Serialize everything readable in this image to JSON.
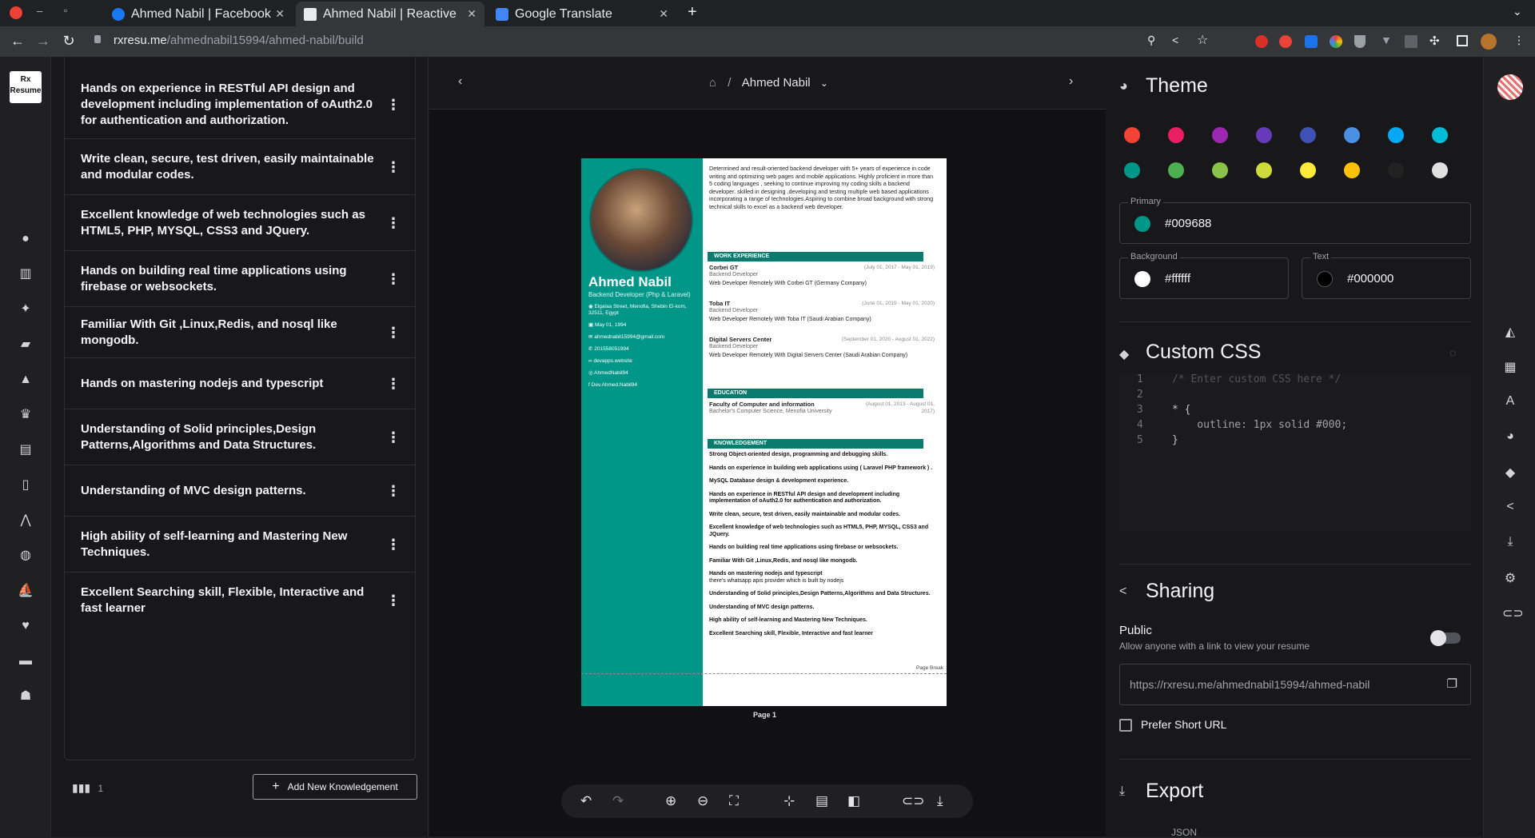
{
  "browser": {
    "tabs": [
      {
        "title": "Ahmed Nabil | Facebook"
      },
      {
        "title": "Ahmed Nabil | Reactive Re"
      },
      {
        "title": "Google Translate"
      }
    ],
    "url_domain": "rxresu.me",
    "url_path": "/ahmednabil15994/ahmed-nabil/build"
  },
  "app": {
    "logo": "Rx Resume"
  },
  "knowledgement": {
    "items": [
      "Hands on experience in RESTful API design and development including implementation of oAuth2.0 for authentication and authorization.",
      "Write clean, secure, test driven, easily maintainable and modular codes.",
      "Excellent knowledge of web technologies such as HTML5, PHP, MYSQL, CSS3 and JQuery.",
      "Hands on building real time applications using firebase or websockets.",
      "Familiar With Git ,Linux,Redis, and nosql like mongodb.",
      "Hands on mastering nodejs and typescript",
      "Understanding of Solid principles,Design Patterns,Algorithms and Data Structures.",
      "Understanding of MVC design patterns.",
      "High ability of self-learning and Mastering New Techniques.",
      "Excellent Searching skill, Flexible, Interactive and fast learner"
    ],
    "columns": "1",
    "add_button": "Add New Knowledgement"
  },
  "center": {
    "breadcrumb_name": "Ahmed Nabil",
    "page_label": "Page 1",
    "page_break": "Page Break"
  },
  "resume": {
    "name": "Ahmed Nabil",
    "title": "Backend Developer (Php & Laravel)",
    "address": "Elgalaa Street, Menofia, Shebin El-kom, 32511, Egypt",
    "birthdate": "May 01, 1994",
    "email": "ahmednabil15994@gmail.com",
    "phone": "201558051994",
    "website": "devapps.website",
    "github": "AhmedNabil94",
    "facebook": "Dev.Ahmed.Nabil94",
    "summary": "Determined and result-oriented backend developer with 5+ years of experience in code writing and optimizing web pages and mobile applications. Highly proficient in more than 5 coding languages , seeking to continue improving my coding skills a backend developer. skilled in designing ,developing and testing multiple web based applications incorporating a range of technologies.Aspiring to combine broad background with strong technical skills to excel as a backend web developer.",
    "sections": {
      "work": "WORK EXPERIENCE",
      "education": "EDUCATION",
      "knowledge": "KNOWLEDGEMENT"
    },
    "work": [
      {
        "company": "Corbei GT",
        "role": "Backend Developer",
        "date": "(July 01, 2017 - May 01, 2019)",
        "desc": "Web Developer Remotely With Corbei GT (Germany Company)"
      },
      {
        "company": "Toba IT",
        "role": "Backend Developer",
        "date": "(June 01, 2019 - May 01, 2020)",
        "desc": "Web Developer Remotely With Toba IT (Saudi Arabian Company)"
      },
      {
        "company": "Digital Servers Center",
        "role": "Backend Developer",
        "date": "(September 01, 2020 - August 01, 2022)",
        "desc": "Web Developer Remotely With Digital Servers Center (Saudi Arabian Company)"
      }
    ],
    "education": {
      "school": "Faculty of Computer and information",
      "degree": "Bachelor's Computer Science, Menofia University",
      "date": "(August 01, 2013 - August 01, 2017)"
    },
    "knowledge": [
      "Strong Object-oriented design, programming and debugging skills.",
      "Hands on experience in building web applications using ( Laravel PHP framework ) .",
      "MySQL Database design & development experience.",
      "Hands on experience in RESTful API design and development including implementation of oAuth2.0 for authentication and authorization.",
      "Write clean, secure, test driven, easily maintainable and modular codes.",
      "Excellent knowledge of web technologies such as HTML5, PHP, MYSQL, CSS3 and JQuery.",
      "Hands on building real time applications using firebase or websockets.",
      "Familiar With Git ,Linux,Redis, and nosql like mongodb.",
      "Hands on mastering nodejs and typescript",
      "there's whatsapp apis provider which is built by nodejs",
      "Understanding of Solid principles,Design Patterns,Algorithms and Data Structures.",
      "Understanding of MVC design patterns.",
      "High ability of self-learning and Mastering New Techniques.",
      "Excellent Searching skill, Flexible, Interactive and fast learner"
    ]
  },
  "theme": {
    "heading": "Theme",
    "swatches": [
      "#f44336",
      "#e91e63",
      "#9c27b0",
      "#673ab7",
      "#3f51b5",
      "#4a90e2",
      "#03a9f4",
      "#00bcd4",
      "#009688",
      "#4caf50",
      "#8bc34a",
      "#cddc39",
      "#ffeb3b",
      "#ffc107",
      "#222222",
      "#e0e0e0"
    ],
    "primary_label": "Primary",
    "primary_value": "#009688",
    "background_label": "Background",
    "background_value": "#ffffff",
    "text_label": "Text",
    "text_value": "#000000"
  },
  "custom_css": {
    "heading": "Custom CSS",
    "line_numbers": [
      "1",
      "2",
      "3",
      "4",
      "5"
    ],
    "lines": [
      "/* Enter custom CSS here */",
      "",
      "* {",
      "    outline: 1px solid #000;",
      "}"
    ]
  },
  "sharing": {
    "heading": "Sharing",
    "public_label": "Public",
    "public_desc": "Allow anyone with a link to view your resume",
    "public_enabled": false,
    "link": "https://rxresu.me/ahmednabil15994/ahmed-nabil",
    "short_url_label": "Prefer Short URL"
  },
  "export": {
    "heading": "Export",
    "json_label": "JSON"
  }
}
